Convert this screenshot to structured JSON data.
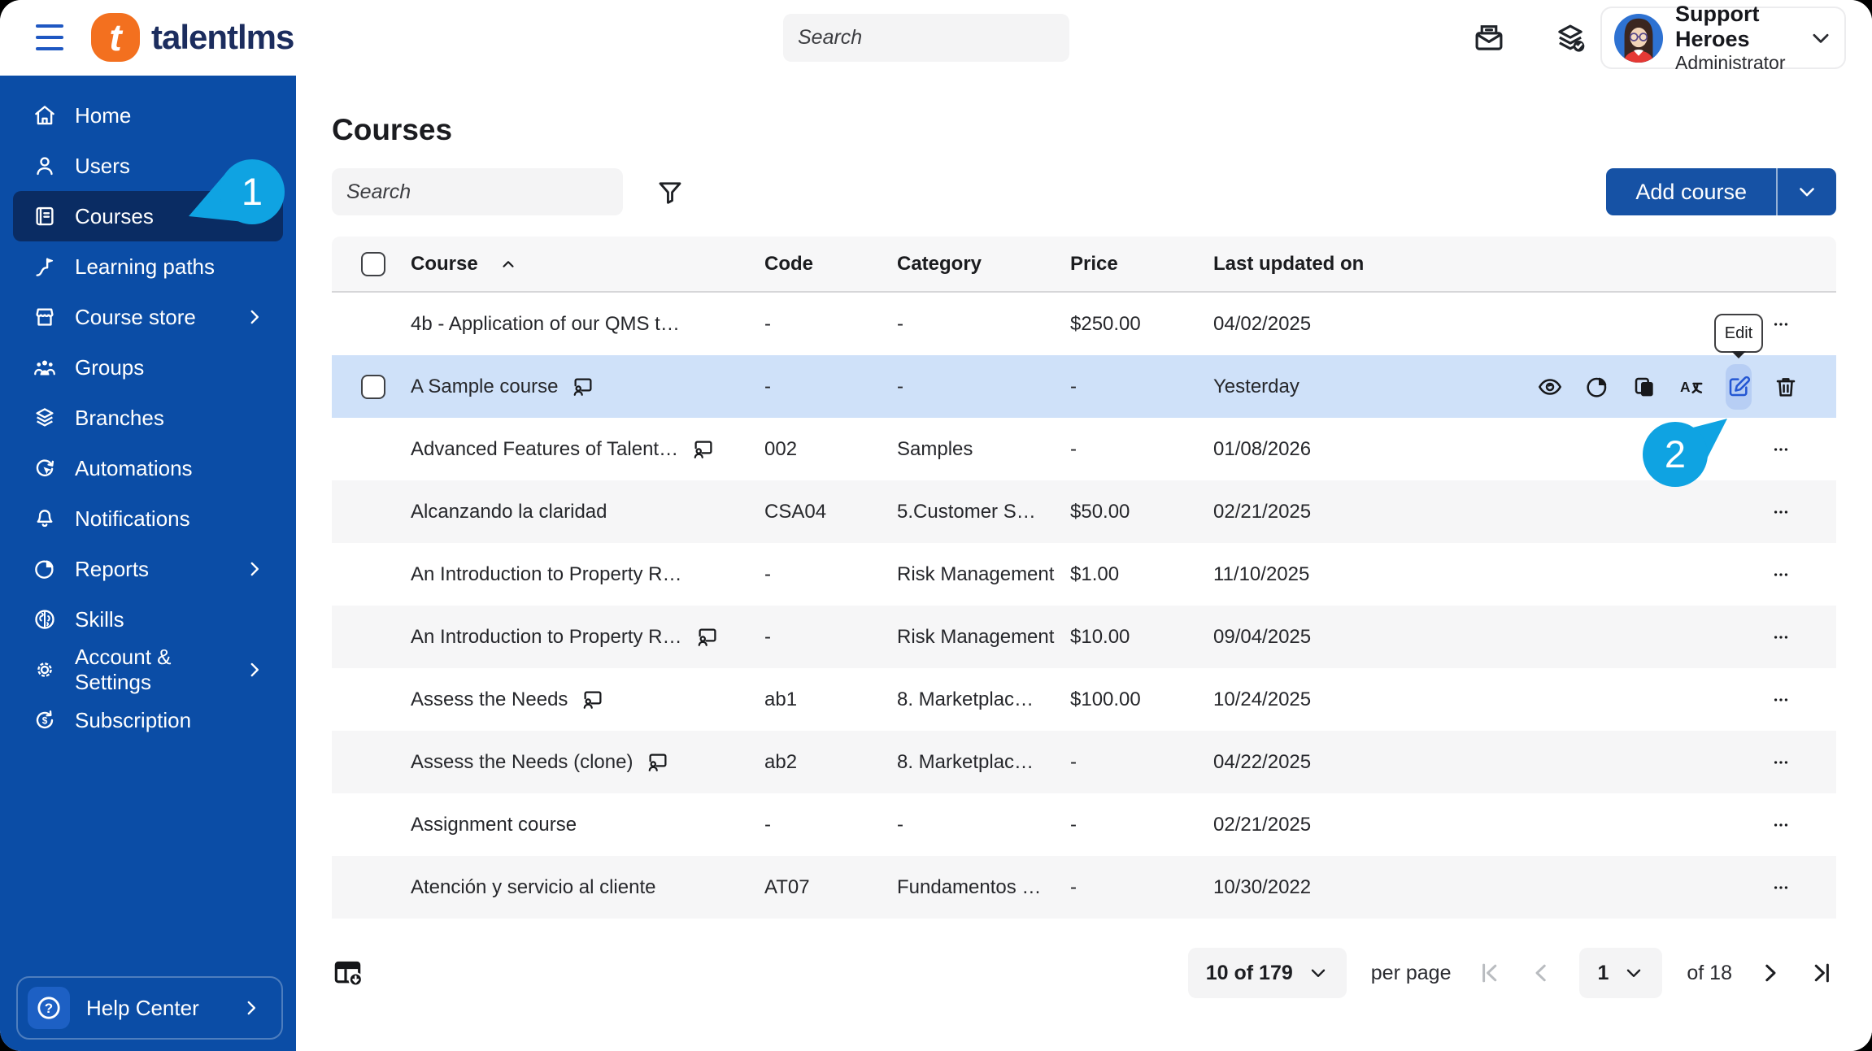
{
  "colors": {
    "sidebar_blue": "#0b4da6",
    "selected_navy": "#0a2c63",
    "callout_blue": "#0fa3e2",
    "brand_orange": "#f3701f",
    "logo_navy": "#1c2d5e",
    "button_blue": "#1652a5",
    "row_highlight": "#cfe1f9",
    "edit_button_bg": "#b7cef4",
    "edit_icon_blue": "#2457d3"
  },
  "topbar": {
    "logo_text": "talentlms",
    "logo_letter": "t",
    "search_placeholder": "Search",
    "user": {
      "name": "Support Heroes",
      "role": "Administrator"
    }
  },
  "sidebar": {
    "items": [
      {
        "label": "Home"
      },
      {
        "label": "Users"
      },
      {
        "label": "Courses",
        "selected": true
      },
      {
        "label": "Learning paths"
      },
      {
        "label": "Course store",
        "chevron": true
      },
      {
        "label": "Groups"
      },
      {
        "label": "Branches"
      },
      {
        "label": "Automations"
      },
      {
        "label": "Notifications"
      },
      {
        "label": "Reports",
        "chevron": true
      },
      {
        "label": "Skills"
      },
      {
        "label": "Account & Settings",
        "chevron": true
      },
      {
        "label": "Subscription"
      }
    ],
    "help_label": "Help Center"
  },
  "main": {
    "title": "Courses",
    "search_placeholder": "Search",
    "add_course_label": "Add course",
    "table": {
      "headers": {
        "course": "Course",
        "code": "Code",
        "category": "Category",
        "price": "Price",
        "updated": "Last updated on"
      },
      "rows": [
        {
          "name": "4b - Application of our QMS t…",
          "ilt": false,
          "code": "-",
          "category": "-",
          "price": "$250.00",
          "updated": "04/02/2025"
        },
        {
          "name": "A Sample course",
          "ilt": true,
          "code": "-",
          "category": "-",
          "price": "-",
          "updated": "Yesterday",
          "highlighted": true
        },
        {
          "name": "Advanced Features of Talent…",
          "ilt": true,
          "code": "002",
          "category": "Samples",
          "price": "-",
          "updated": "01/08/2026"
        },
        {
          "name": "Alcanzando la claridad",
          "ilt": false,
          "code": "CSA04",
          "category": "5.Customer S…",
          "price": "$50.00",
          "updated": "02/21/2025"
        },
        {
          "name": "An Introduction to Property R…",
          "ilt": false,
          "code": "-",
          "category": "Risk Management",
          "price": "$1.00",
          "updated": "11/10/2025"
        },
        {
          "name": "An Introduction to Property R…",
          "ilt": true,
          "code": "-",
          "category": "Risk Management",
          "price": "$10.00",
          "updated": "09/04/2025"
        },
        {
          "name": "Assess the Needs",
          "ilt": true,
          "code": "ab1",
          "category": "8. Marketplac…",
          "price": "$100.00",
          "updated": "10/24/2025"
        },
        {
          "name": "Assess the Needs (clone)",
          "ilt": true,
          "code": "ab2",
          "category": "8. Marketplac…",
          "price": "-",
          "updated": "04/22/2025"
        },
        {
          "name": "Assignment course",
          "ilt": false,
          "code": "-",
          "category": "-",
          "price": "-",
          "updated": "02/21/2025"
        },
        {
          "name": "Atención y servicio al cliente",
          "ilt": false,
          "code": "AT07",
          "category": "Fundamentos …",
          "price": "-",
          "updated": "10/30/2022"
        }
      ]
    },
    "tooltip_label": "Edit",
    "callout_one": "1",
    "callout_two": "2",
    "pagination": {
      "page_size": "10 of 179",
      "per_page_label": "per page",
      "page": "1",
      "total_label": "of 18"
    }
  }
}
